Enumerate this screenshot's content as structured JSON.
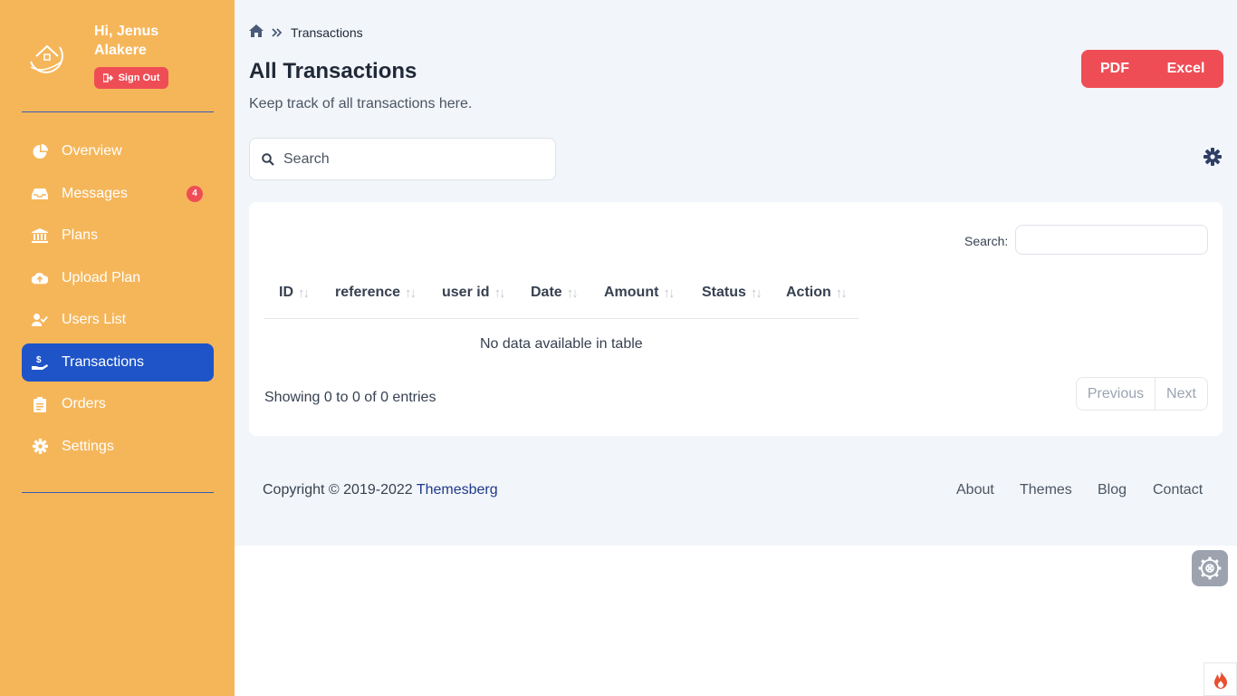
{
  "sidebar": {
    "user": {
      "greeting": "Hi, Jenus Alakere",
      "signout_label": "Sign Out"
    },
    "items": [
      {
        "label": "Overview",
        "icon": "pie-chart-icon"
      },
      {
        "label": "Messages",
        "icon": "inbox-icon",
        "badge": "4"
      },
      {
        "label": "Plans",
        "icon": "bank-icon"
      },
      {
        "label": "Upload Plan",
        "icon": "cloud-upload-icon"
      },
      {
        "label": "Users List",
        "icon": "user-check-icon"
      },
      {
        "label": "Transactions",
        "icon": "hand-holding-dollar-icon",
        "active": true
      },
      {
        "label": "Orders",
        "icon": "clipboard-icon"
      },
      {
        "label": "Settings",
        "icon": "gear-icon"
      }
    ]
  },
  "breadcrumb": {
    "current": "Transactions"
  },
  "page": {
    "title": "All Transactions",
    "subtitle": "Keep track of all transactions here."
  },
  "export": {
    "pdf_label": "PDF",
    "excel_label": "Excel"
  },
  "search": {
    "placeholder": "Search"
  },
  "table": {
    "search_label": "Search:",
    "columns": [
      "ID",
      "reference",
      "user id",
      "Date",
      "Amount",
      "Status",
      "Action"
    ],
    "sort_glyph": "↑↓",
    "empty_message": "No data available in table",
    "info": "Showing 0 to 0 of 0 entries",
    "pager": {
      "previous": "Previous",
      "next": "Next"
    }
  },
  "footer": {
    "copyright_prefix": "Copyright © 2019-2022",
    "brand": "Themesberg",
    "links": [
      "About",
      "Themes",
      "Blog",
      "Contact"
    ]
  },
  "colors": {
    "sidebar_bg": "#f5b65a",
    "active_nav": "#1e54c8",
    "danger": "#ef4d56",
    "main_bg": "#f2f5f9"
  }
}
